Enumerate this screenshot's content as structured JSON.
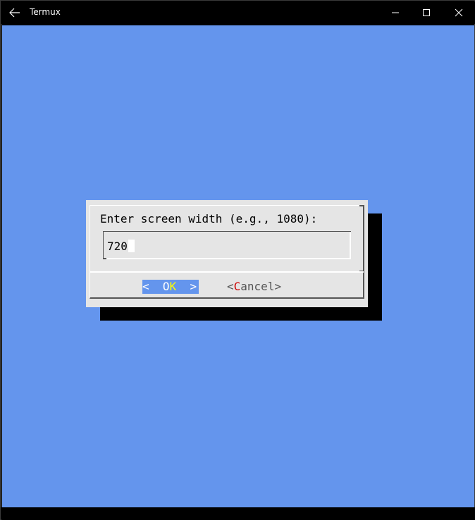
{
  "window": {
    "title": "Termux",
    "background_color": "#6495ed"
  },
  "dialog": {
    "prompt": "Enter screen width (e.g., 1080):",
    "input_value": "720",
    "ok_button": {
      "left": "<  ",
      "hotkey": "O",
      "rest": "K",
      "right": "  >"
    },
    "cancel_button": {
      "left": "<",
      "hotkey": "C",
      "rest": "ancel",
      "right": ">"
    }
  },
  "colors": {
    "dialog_bg": "#e5e5e5",
    "selected_button_bg": "#6495ed",
    "hotkey_selected": "#ffff00",
    "hotkey_unselected": "#cc0000"
  }
}
